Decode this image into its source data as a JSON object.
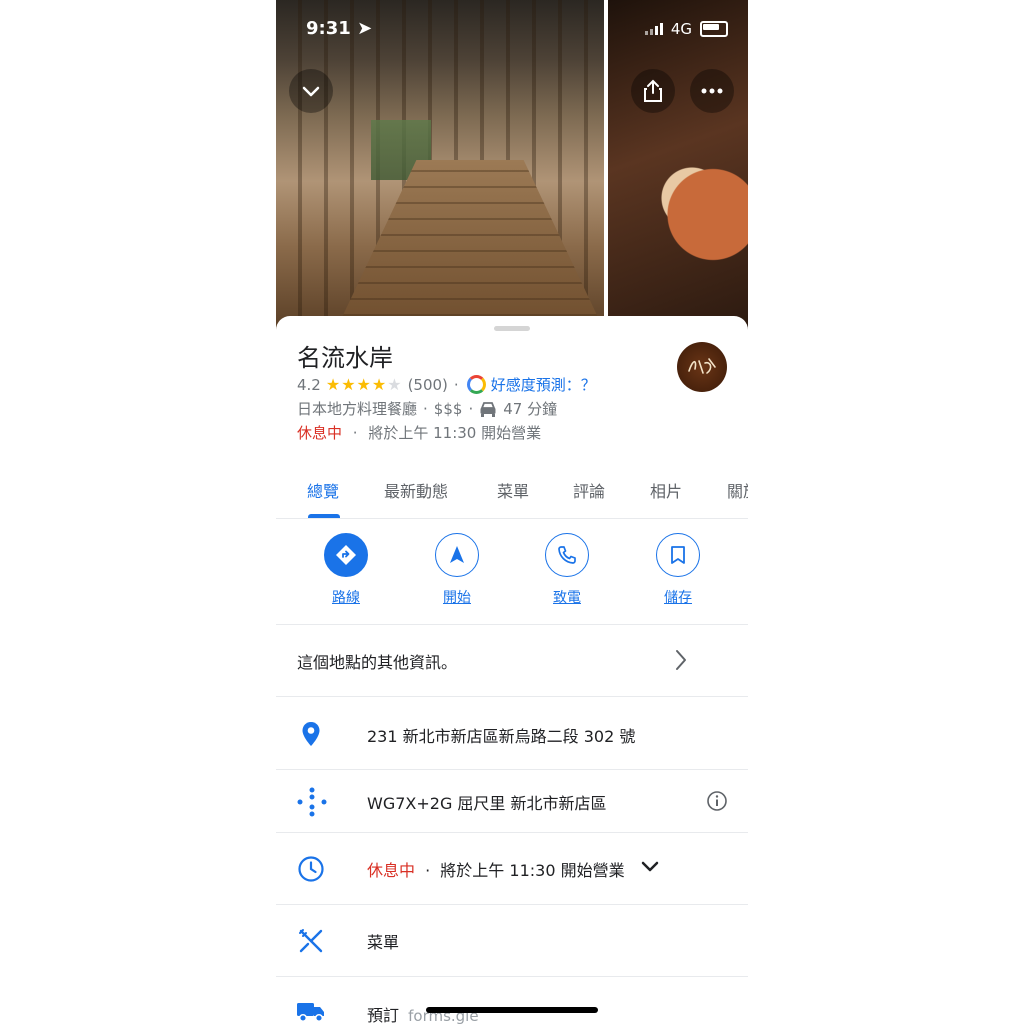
{
  "status_bar": {
    "time": "9:31",
    "network": "4G"
  },
  "place": {
    "name": "名流水岸",
    "rating": "4.2",
    "stars": 4,
    "review_count": "(500)",
    "vibe_label": "好感度預測：？",
    "category": "日本地方料理餐廳",
    "price": "$$$",
    "drive_time": "47 分鐘",
    "status_closed": "休息中",
    "opens_text": "將於上午 11:30 開始營業"
  },
  "tabs": [
    {
      "label": "總覽"
    },
    {
      "label": "最新動態"
    },
    {
      "label": "菜單"
    },
    {
      "label": "評論"
    },
    {
      "label": "相片"
    },
    {
      "label": "關於"
    }
  ],
  "actions": [
    {
      "label": "路線",
      "icon": "directions-icon"
    },
    {
      "label": "開始",
      "icon": "navigation-icon"
    },
    {
      "label": "致電",
      "icon": "phone-icon"
    },
    {
      "label": "儲存",
      "icon": "bookmark-icon"
    }
  ],
  "rows": {
    "more_info": "這個地點的其他資訊。",
    "address": "231 新北市新店區新烏路二段 302 號",
    "plus_code": "WG7X+2G 屈尺里 新北市新店區",
    "hours_closed": "休息中",
    "hours_text": "將於上午 11:30 開始營業",
    "menu": "菜單",
    "reserve": "預訂",
    "reserve_link": "forms.gle"
  },
  "colors": {
    "accent": "#1a73e8",
    "closed": "#d93025",
    "star": "#fbbc04"
  }
}
